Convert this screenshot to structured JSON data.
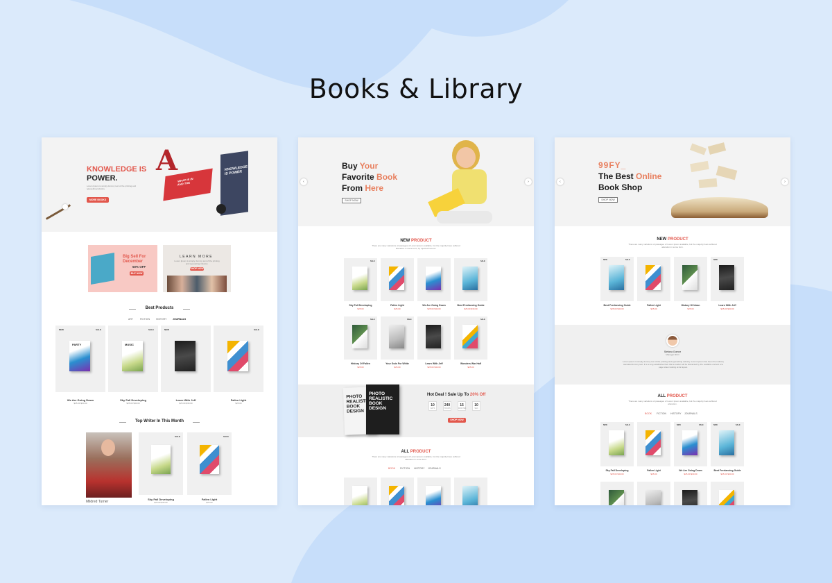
{
  "page_title": "Books & Library",
  "colors": {
    "background": "#dbeafb",
    "blob": "#c7defa",
    "accent_red": "#e2574c",
    "accent_orange": "#e87f5e"
  },
  "panel1": {
    "hero": {
      "headline_line1": "KNOWLEDGE IS",
      "headline_line2": "POWER.",
      "sub": "Lorem Ipsum is simply dummy text of the printing and typesetting industry.",
      "button": "MORE BOOKS",
      "book_cover_text": "KNOWLEDGE IS POWER",
      "book_spine_text": "WHAT IS IN AND THE"
    },
    "promo1": {
      "line1": "Big Sell For",
      "line2": "December",
      "line3": "50% OFF",
      "button": "BUY NOW"
    },
    "promo2": {
      "title": "LEARN MORE",
      "sub": "Lorem Ipsum is simply dummy text of the printing and typesetting industry.",
      "button": "SHOP NOW"
    },
    "best_products": {
      "heading": "Best Products",
      "tabs": [
        "ART",
        "FICTION",
        "HISTORY",
        "JOURNALS"
      ]
    },
    "products": [
      {
        "tag": "NEW",
        "tag2": "SALE",
        "cover": "PARTY",
        "name": "We Are Going Down",
        "price": "$25.00 $30.00"
      },
      {
        "tag": "",
        "tag2": "SALE",
        "cover": "MUSIC",
        "name": "Sky Fall Developing",
        "price": "$25.00 $30.00"
      },
      {
        "tag": "NEW",
        "tag2": "",
        "cover": "",
        "name": "Learn With Jeff",
        "price": "$25.00 $30.00"
      },
      {
        "tag": "",
        "tag2": "SALE",
        "cover": "",
        "name": "Fallen Light",
        "price": "$25.00"
      }
    ],
    "top_writer": {
      "heading": "Top Writer In This Month",
      "writer_name": "Mildred Turner"
    },
    "writer_books": [
      {
        "tag": "SALE",
        "name": "Sky Fall Developing",
        "price": "$25.00 $30.00"
      },
      {
        "tag": "SALE",
        "name": "Fallen Light",
        "price": "$25.00"
      }
    ]
  },
  "panel2": {
    "hero": {
      "w1": "Buy",
      "w2": "Your",
      "w3": "Favorite",
      "w4": "Book",
      "w5": "From",
      "w6": "Here",
      "button": "SHOP NOW"
    },
    "new_product": {
      "heading_a": "NEW",
      "heading_b": "PRODUCT",
      "sub": "There are many variations of passages of Lorem Ipsum available, but the majority have suffered alteration in some form, by injected humour."
    },
    "products": [
      {
        "tag": "SALE",
        "name": "Sky Fall Developing",
        "price": "$25.00"
      },
      {
        "tag": "",
        "name": "Fallen Light",
        "price": "$25.00"
      },
      {
        "tag": "",
        "name": "We Are Going Down",
        "price": "$25.00 $30.00"
      },
      {
        "tag": "SALE",
        "name": "Best Freelancing Guide",
        "price": "$25.00 $30.00"
      },
      {
        "tag": "SALE",
        "name": "History Of Fallen",
        "price": "$25.00"
      },
      {
        "tag": "SALE",
        "name": "Your Guts For White",
        "price": "$25.00"
      },
      {
        "tag": "",
        "name": "Learn With Jeff",
        "price": "$25.00 $30.00"
      },
      {
        "tag": "SALE",
        "name": "Wonders War Half",
        "price": "$25.00"
      }
    ],
    "deal": {
      "book1": "PHOTO REALISTIC BOOK DESIGN",
      "book2": "PHOTO REALISTIC BOOK DESIGN",
      "title_a": "Hot Deal ! Sale Up To",
      "title_b": "20% Off",
      "countdown": [
        {
          "v": "10",
          "l": "DAYS"
        },
        {
          "v": "240",
          "l": "HOURS"
        },
        {
          "v": "15",
          "l": "MINUTES"
        },
        {
          "v": "10",
          "l": "SEC"
        }
      ],
      "button": "SHOP NOW"
    },
    "all_product": {
      "heading_a": "ALL",
      "heading_b": "PRODUCT",
      "sub": "There are many variations of passages of Lorem Ipsum available, but the majority have suffered alteration in some form.",
      "tabs": [
        "BOOK",
        "FICTION",
        "HISTORY",
        "JOURNALS"
      ]
    }
  },
  "panel3": {
    "hero": {
      "brand": "99FY_",
      "w1": "The Best",
      "w2": "Online",
      "w3": "Book Shop",
      "button": "SHOP NOW"
    },
    "new_product": {
      "heading_a": "NEW",
      "heading_b": "PRODUCT",
      "sub": "There are many variations of passages of Lorem Ipsum available, but the majority have suffered alteration in some form."
    },
    "products": [
      {
        "tag": "NEW",
        "tag2": "SALE",
        "name": "Best Freelancing Guide",
        "price": "$25.00 $30.00"
      },
      {
        "tag": "",
        "tag2": "",
        "name": "Fallen Light",
        "price": "$25.00"
      },
      {
        "tag": "",
        "tag2": "",
        "name": "History Of Idean",
        "price": "$25.00"
      },
      {
        "tag": "NEW",
        "tag2": "",
        "name": "Learn With Jeff",
        "price": "$25.00 $30.00"
      }
    ],
    "testimonial": {
      "name": "Stefana Gomez",
      "role": "Manager RCO",
      "quote": "Lorem ipsum is simply dummy text of the printing and typesetting industry. Lorem Ipsum has been the industry standard dummy text. It is a long established fact that a reader will be distracted by the readable content of a page when looking at its layout."
    },
    "all_product": {
      "heading_a": "ALL",
      "heading_b": "PRODUCT",
      "sub": "There are many variations of passages of Lorem Ipsum available, but the majority have suffered alteration.",
      "tabs": [
        "BOOK",
        "FICTION",
        "HISTORY",
        "JOURNALS"
      ]
    },
    "products2": [
      {
        "tag": "NEW",
        "tag2": "SALE",
        "name": "Sky Fall Developing",
        "price": "$25.00 $30.00"
      },
      {
        "tag": "",
        "tag2": "",
        "name": "Fallen Light",
        "price": "$25.00"
      },
      {
        "tag": "NEW",
        "tag2": "SALE",
        "name": "We Are Going Down",
        "price": "$25.00 $30.00"
      },
      {
        "tag": "NEW",
        "tag2": "SALE",
        "name": "Best Freelancing Guide",
        "price": "$25.00 $30.00"
      }
    ]
  }
}
